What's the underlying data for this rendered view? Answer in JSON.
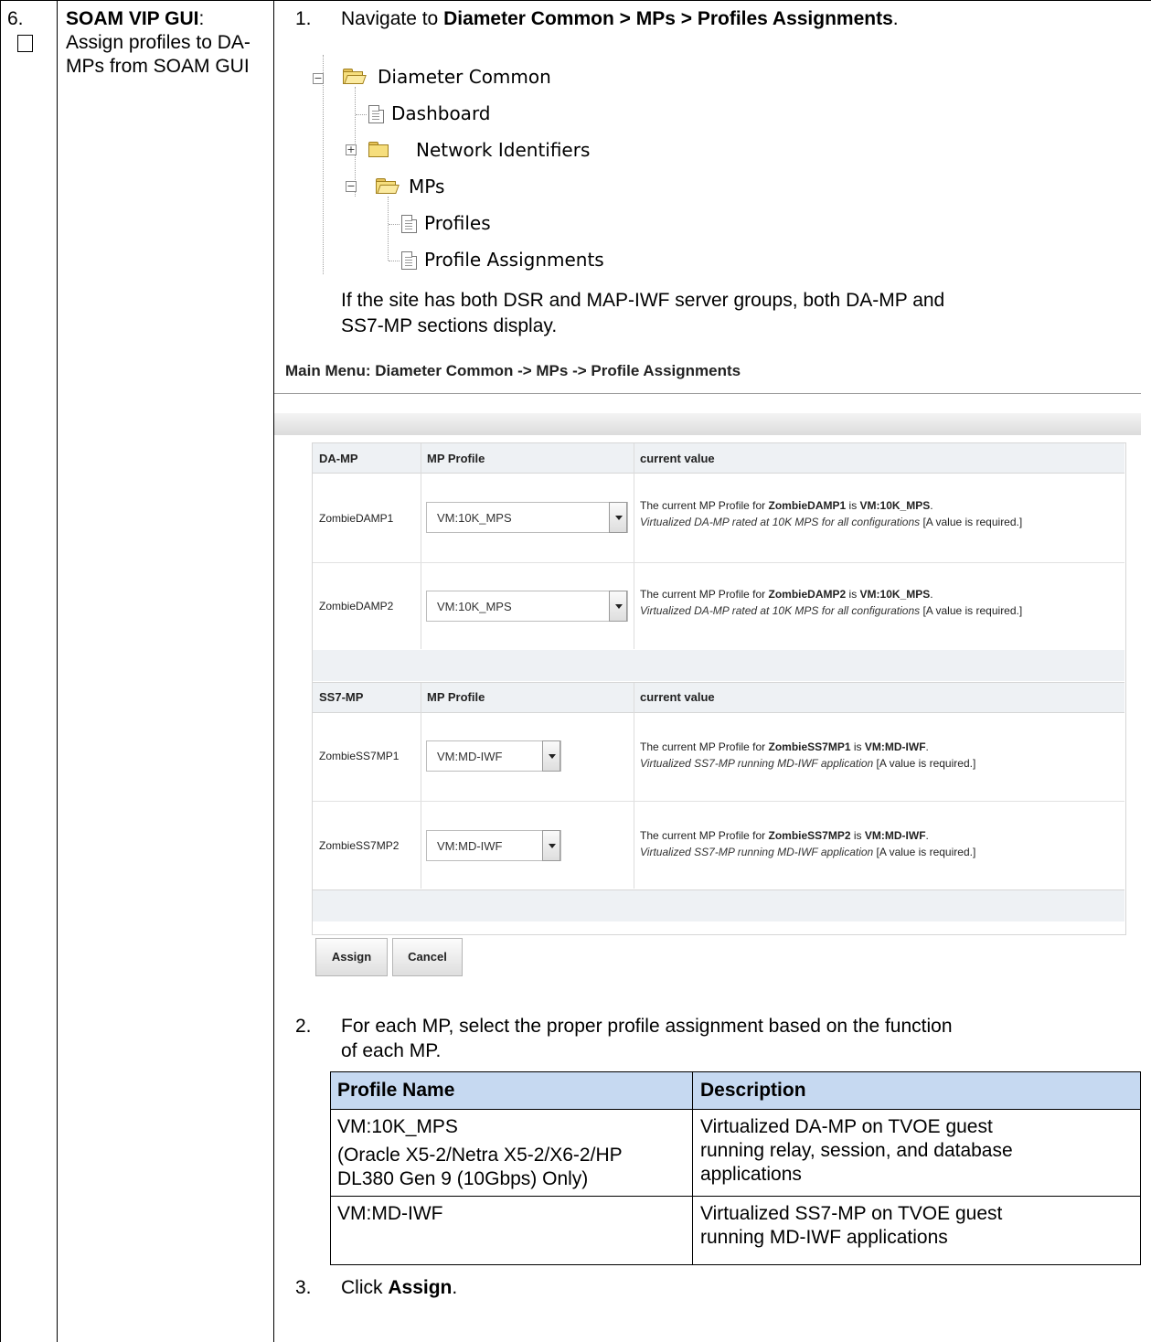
{
  "step": {
    "number": "6.",
    "title_bold": "SOAM VIP GUI",
    "title_colon": ":",
    "description": "Assign profiles to DA-MPs from SOAM GUI"
  },
  "instructions": {
    "item1_num": "1.",
    "item1_prefix": "Navigate to ",
    "item1_bold": "Diameter Common > MPs > Profiles Assignments",
    "item1_suffix": ".",
    "note_line1": "If the site has both DSR and MAP-IWF server groups, both DA-MP and",
    "note_line2": "SS7-MP sections display.",
    "item2_num": "2.",
    "item2_line1": "For each MP, select the proper profile assignment based on the function",
    "item2_line2": "of each MP.",
    "item3_num": "3.",
    "item3_prefix": "Click ",
    "item3_bold": "Assign",
    "item3_suffix": "."
  },
  "tree": {
    "root": "Diameter Common",
    "dashboard": "Dashboard",
    "network_identifiers": "Network Identifiers",
    "mps": "MPs",
    "profiles": "Profiles",
    "profile_assignments": "Profile Assignments",
    "collapse_glyph": "−",
    "expand_glyph": "+"
  },
  "gui": {
    "title": "Main Menu: Diameter Common -> MPs -> Profile Assignments",
    "damp_section": {
      "col1": "DA-MP",
      "col2": "MP Profile",
      "col3": "current value",
      "rows": [
        {
          "name": "ZombieDAMP1",
          "profile": "VM:10K_MPS",
          "cur_prefix": "The current MP Profile for ",
          "cur_name": "ZombieDAMP1",
          "cur_mid": " is ",
          "cur_value": "VM:10K_MPS",
          "cur_end": ".",
          "desc": "Virtualized DA-MP rated at 10K MPS for all configurations",
          "req": " [A value is required.]"
        },
        {
          "name": "ZombieDAMP2",
          "profile": "VM:10K_MPS",
          "cur_prefix": "The current MP Profile for ",
          "cur_name": "ZombieDAMP2",
          "cur_mid": " is ",
          "cur_value": "VM:10K_MPS",
          "cur_end": ".",
          "desc": "Virtualized DA-MP rated at 10K MPS for all configurations",
          "req": " [A value is required.]"
        }
      ]
    },
    "ss7_section": {
      "col1": "SS7-MP",
      "col2": "MP Profile",
      "col3": "current value",
      "rows": [
        {
          "name": "ZombieSS7MP1",
          "profile": "VM:MD-IWF",
          "cur_prefix": "The current MP Profile for ",
          "cur_name": "ZombieSS7MP1",
          "cur_mid": " is ",
          "cur_value": "VM:MD-IWF",
          "cur_end": ".",
          "desc": "Virtualized SS7-MP running MD-IWF application",
          "req": " [A value is required.]"
        },
        {
          "name": "ZombieSS7MP2",
          "profile": "VM:MD-IWF",
          "cur_prefix": "The current MP Profile for ",
          "cur_name": "ZombieSS7MP2",
          "cur_mid": " is ",
          "cur_value": "VM:MD-IWF",
          "cur_end": ".",
          "desc": "Virtualized SS7-MP running MD-IWF application",
          "req": " [A value is required.]"
        }
      ]
    },
    "assign_button": "Assign",
    "cancel_button": "Cancel"
  },
  "profile_table": {
    "header_name": "Profile Name",
    "header_desc": "Description",
    "rows": [
      {
        "name_l1": "VM:10K_MPS",
        "name_l2": "(Oracle X5-2/Netra X5-2/X6-2/HP",
        "name_l3": "DL380 Gen 9 (10Gbps) Only)",
        "desc_l1": "Virtualized DA-MP on TVOE guest",
        "desc_l2": "running relay, session, and database",
        "desc_l3": "applications"
      },
      {
        "name_l1": "VM:MD-IWF",
        "desc_l1": "Virtualized SS7-MP on TVOE guest",
        "desc_l2": "running MD-IWF applications"
      }
    ]
  }
}
